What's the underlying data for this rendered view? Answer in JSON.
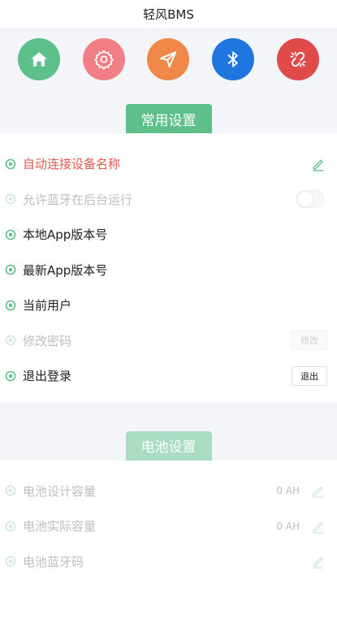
{
  "app": {
    "title": "轻风BMS"
  },
  "nav": {
    "home": {
      "icon": "home-icon",
      "color": "#5dbf8a"
    },
    "settings": {
      "icon": "gear-icon",
      "color": "#f07f86"
    },
    "send": {
      "icon": "send-icon",
      "color": "#f0884a"
    },
    "bluetooth": {
      "icon": "bluetooth-icon",
      "color": "#1e76de"
    },
    "unlink": {
      "icon": "broken-link-icon",
      "color": "#e04b4a"
    }
  },
  "common": {
    "tab_label": "常用设置",
    "tab_color": "#5dbf8a",
    "rows": {
      "auto_connect": {
        "label": "自动连接设备名称"
      },
      "bg_run": {
        "label": "允许蓝牙在后台运行"
      },
      "local_version": {
        "label": "本地App版本号"
      },
      "latest_version": {
        "label": "最新App版本号"
      },
      "current_user": {
        "label": "当前用户"
      },
      "change_password": {
        "label": "修改密码",
        "button": "修改"
      },
      "logout": {
        "label": "退出登录",
        "button": "退出"
      }
    }
  },
  "battery": {
    "tab_label": "电池设置",
    "tab_color": "#a9dcc2",
    "rows": {
      "design_capacity": {
        "label": "电池设计容量",
        "value": "0 AH"
      },
      "actual_capacity": {
        "label": "电池实际容量",
        "value": "0 AH"
      },
      "bt_code": {
        "label": "电池蓝牙码"
      }
    }
  },
  "colors": {
    "accent_red": "#e25a4f",
    "accent_green": "#5dbf8a",
    "disabled": "#bdbdbd"
  }
}
